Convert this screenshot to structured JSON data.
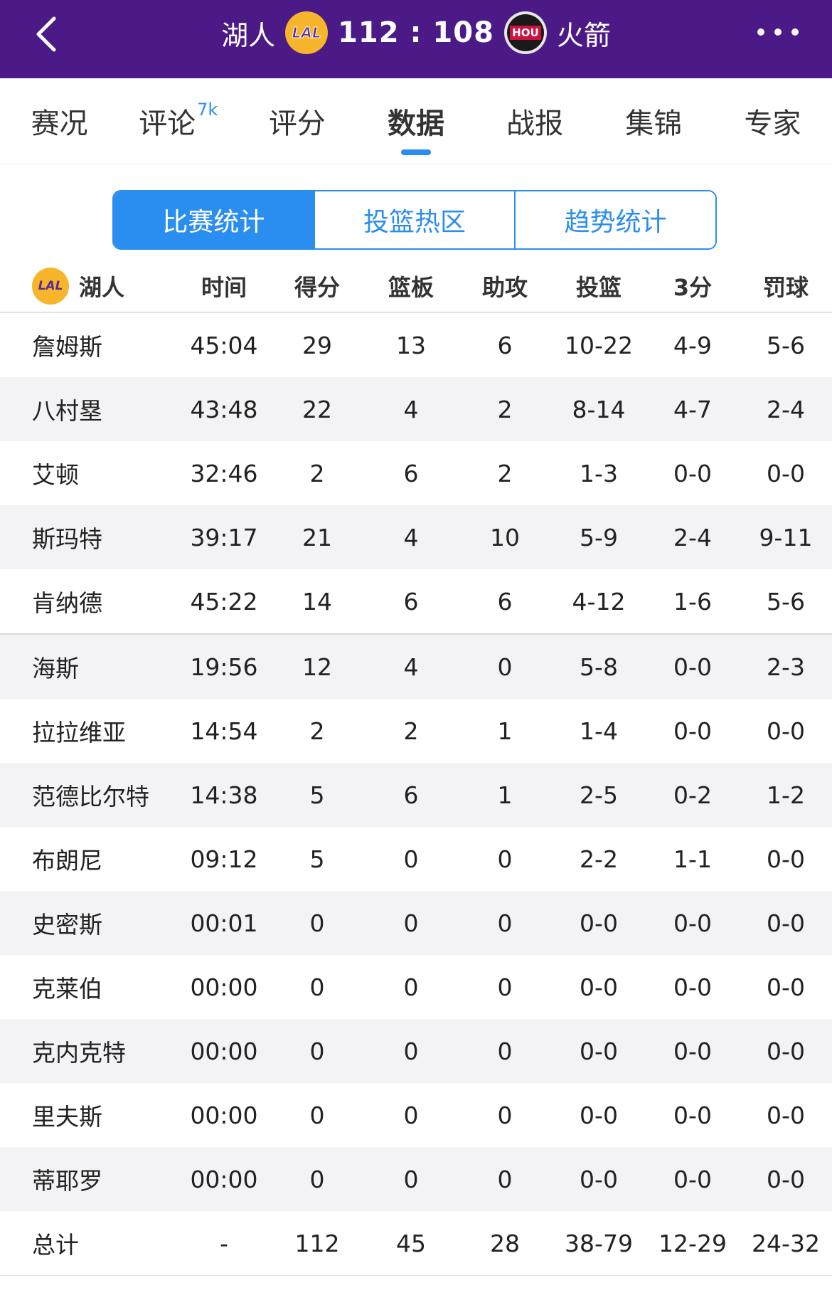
{
  "header": {
    "home_team": "湖人",
    "away_team": "火箭",
    "home_logo_text": "LAL",
    "away_logo_text": "HOU",
    "score": "112 : 108",
    "back_icon": "chevron-left-icon",
    "more_icon": "more-horizontal-icon"
  },
  "tabs": [
    {
      "label": "赛况"
    },
    {
      "label": "评论",
      "badge": "7k"
    },
    {
      "label": "评分"
    },
    {
      "label": "数据",
      "active": true
    },
    {
      "label": "战报"
    },
    {
      "label": "集锦"
    },
    {
      "label": "专家"
    }
  ],
  "segments": [
    {
      "label": "比赛统计",
      "active": true
    },
    {
      "label": "投篮热区"
    },
    {
      "label": "趋势统计"
    }
  ],
  "table": {
    "team_name": "湖人",
    "team_logo_text": "LAL",
    "columns": [
      "时间",
      "得分",
      "篮板",
      "助攻",
      "投篮",
      "3分",
      "罚球"
    ],
    "rows": [
      [
        "詹姆斯",
        "45:04",
        "29",
        "13",
        "6",
        "10-22",
        "4-9",
        "5-6"
      ],
      [
        "八村塁",
        "43:48",
        "22",
        "4",
        "2",
        "8-14",
        "4-7",
        "2-4"
      ],
      [
        "艾顿",
        "32:46",
        "2",
        "6",
        "2",
        "1-3",
        "0-0",
        "0-0"
      ],
      [
        "斯玛特",
        "39:17",
        "21",
        "4",
        "10",
        "5-9",
        "2-4",
        "9-11"
      ],
      [
        "肯纳德",
        "45:22",
        "14",
        "6",
        "6",
        "4-12",
        "1-6",
        "5-6"
      ],
      [
        "海斯",
        "19:56",
        "12",
        "4",
        "0",
        "5-8",
        "0-0",
        "2-3"
      ],
      [
        "拉拉维亚",
        "14:54",
        "2",
        "2",
        "1",
        "1-4",
        "0-0",
        "0-0"
      ],
      [
        "范德比尔特",
        "14:38",
        "5",
        "6",
        "1",
        "2-5",
        "0-2",
        "1-2"
      ],
      [
        "布朗尼",
        "09:12",
        "5",
        "0",
        "0",
        "2-2",
        "1-1",
        "0-0"
      ],
      [
        "史密斯",
        "00:01",
        "0",
        "0",
        "0",
        "0-0",
        "0-0",
        "0-0"
      ],
      [
        "克莱伯",
        "00:00",
        "0",
        "0",
        "0",
        "0-0",
        "0-0",
        "0-0"
      ],
      [
        "克内克特",
        "00:00",
        "0",
        "0",
        "0",
        "0-0",
        "0-0",
        "0-0"
      ],
      [
        "里夫斯",
        "00:00",
        "0",
        "0",
        "0",
        "0-0",
        "0-0",
        "0-0"
      ],
      [
        "蒂耶罗",
        "00:00",
        "0",
        "0",
        "0",
        "0-0",
        "0-0",
        "0-0"
      ]
    ],
    "total": [
      "总计",
      "-",
      "112",
      "45",
      "28",
      "38-79",
      "12-29",
      "24-32"
    ]
  },
  "colors": {
    "topbar": "#4b1a86",
    "accent": "#2a8ef0",
    "lakers_gold": "#f7b52c",
    "lakers_purple": "#5a2d91"
  }
}
